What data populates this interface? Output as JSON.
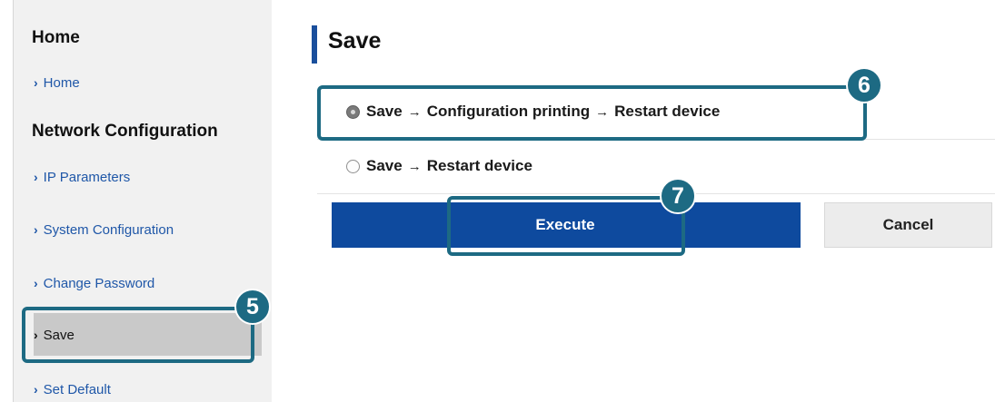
{
  "sidebar": {
    "section_home": "Home",
    "link_home": "Home",
    "section_network": "Network Configuration",
    "items": [
      {
        "label": "IP Parameters"
      },
      {
        "label": "System Configuration"
      },
      {
        "label": "Change Password"
      },
      {
        "label": "Save"
      },
      {
        "label": "Set Default"
      }
    ],
    "chevron": "›"
  },
  "main": {
    "title": "Save",
    "options": [
      {
        "parts": [
          "Save",
          "Configuration printing",
          "Restart device"
        ],
        "checked": true
      },
      {
        "parts": [
          "Save",
          "Restart device"
        ],
        "checked": false
      }
    ],
    "arrow": "→",
    "execute_label": "Execute",
    "cancel_label": "Cancel"
  },
  "callouts": {
    "five": "5",
    "six": "6",
    "seven": "7"
  },
  "colors": {
    "primary_blue": "#0e4a9e",
    "callout_teal": "#1d6a83",
    "sidebar_bg": "#f1f1f1"
  }
}
